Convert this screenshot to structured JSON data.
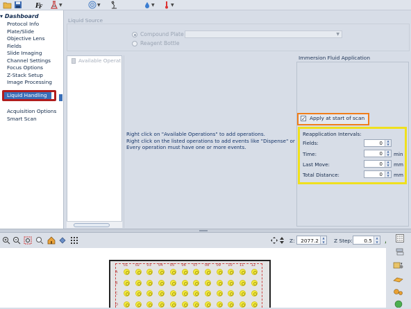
{
  "toolbar": {
    "icons": [
      "ff-icon",
      "flask-icon",
      "target-icon",
      "microscope-icon",
      "drop-icon",
      "thermometer-icon"
    ]
  },
  "tree": {
    "root": "Dashboard",
    "items": [
      {
        "label": "Protocol Info"
      },
      {
        "label": "Plate/Slide"
      },
      {
        "label": "Objective Lens"
      },
      {
        "label": "Fields"
      },
      {
        "label": "Slide Imaging"
      },
      {
        "label": "Channel Settings"
      },
      {
        "label": "Focus Options"
      },
      {
        "label": "Z-Stack Setup"
      },
      {
        "label": "Image Processing"
      },
      {
        "label": "Liquid Handling",
        "selected": true
      },
      {
        "label": "Acquisition Options"
      },
      {
        "label": "Smart Scan"
      }
    ]
  },
  "liquid_source": {
    "title": "Liquid Source",
    "option_compound": "Compound Plate",
    "option_reagent": "Reagent Bottle",
    "selected": "Compound Plate"
  },
  "operations": {
    "item": "Available Operations",
    "instructions": [
      "Right click on \"Available Operations\" to add operations.",
      "Right click on the listed operations to add events like \"Dispense\" or \"As",
      "Every operation must have one or more events."
    ]
  },
  "immersion": {
    "title": "Immersion Fluid Application",
    "apply_label": "Apply at start of scan",
    "apply_checked": true,
    "reapp_title": "Reapplication Intervals:",
    "fields": [
      {
        "label": "Fields:",
        "value": "0",
        "unit": ""
      },
      {
        "label": "Time:",
        "value": "0",
        "unit": "min"
      },
      {
        "label": "Last Move:",
        "value": "0",
        "unit": "mm"
      },
      {
        "label": "Total Distance:",
        "value": "0",
        "unit": "mm"
      }
    ]
  },
  "bottom": {
    "z_label": "Z:",
    "z_value": "2077.2",
    "zstep_label": "Z Step:",
    "zstep_value": "0.5"
  },
  "plate_map": {
    "columns": [
      "01",
      "02",
      "03",
      "04",
      "05",
      "06",
      "07",
      "08",
      "09",
      "10",
      "11",
      "12"
    ],
    "rows": [
      "A",
      "B",
      "C",
      "D"
    ]
  },
  "colors": {
    "selection": "#3a6fb8",
    "highlight_red": "#b01d1d",
    "highlight_orange": "#f07d1a",
    "highlight_yellow": "#efe01e",
    "well_fill": "#f3ec3d"
  }
}
